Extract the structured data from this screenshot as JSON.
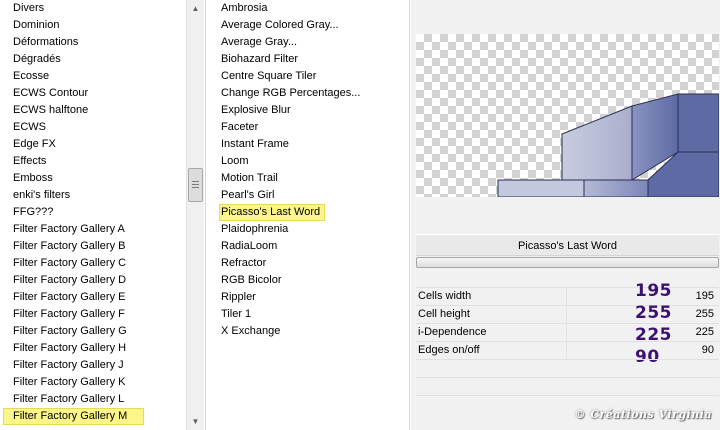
{
  "categories": {
    "items": [
      "Divers",
      "Dominion",
      "Déformations",
      "Dégradés",
      "Ecosse",
      "ECWS Contour",
      "ECWS halftone",
      "ECWS",
      "Edge FX",
      "Effects",
      "Emboss",
      "enki's filters",
      "FFG???",
      "Filter Factory Gallery A",
      "Filter Factory Gallery B",
      "Filter Factory Gallery C",
      "Filter Factory Gallery D",
      "Filter Factory Gallery E",
      "Filter Factory Gallery F",
      "Filter Factory Gallery G",
      "Filter Factory Gallery H",
      "Filter Factory Gallery J",
      "Filter Factory Gallery K",
      "Filter Factory Gallery L",
      "Filter Factory Gallery M"
    ],
    "selected": "Filter Factory Gallery M"
  },
  "filters": {
    "items": [
      "Ambrosia",
      "Average Colored Gray...",
      "Average Gray...",
      "Biohazard Filter",
      "Centre Square Tiler",
      "Change RGB Percentages...",
      "Explosive Blur",
      "Faceter",
      "Instant Frame",
      "Loom",
      "Motion Trail",
      "Pearl's Girl",
      "Picasso's Last Word",
      "Plaidophrenia",
      "RadiaLoom",
      "Refractor",
      "RGB Bicolor",
      "Rippler",
      "Tiler 1",
      "X Exchange"
    ],
    "selected": "Picasso's Last Word"
  },
  "panel": {
    "filter_name": "Picasso's Last Word",
    "params": [
      {
        "label": "Cells width",
        "value": "195",
        "display": "195"
      },
      {
        "label": "Cell height",
        "value": "255",
        "display": "255"
      },
      {
        "label": "i-Dependence",
        "value": "225",
        "display": "225"
      },
      {
        "label": "Edges on/off",
        "value": "90",
        "display": "90"
      }
    ],
    "watermark": "© Créations Virginia"
  },
  "colors": {
    "selection_highlight": "#fbf58a",
    "big_number": "#3b1173",
    "preview_block": "#5d6aa4"
  },
  "icons": {
    "scroll_up": "triangle-up-icon",
    "scroll_down": "triangle-down-icon"
  }
}
